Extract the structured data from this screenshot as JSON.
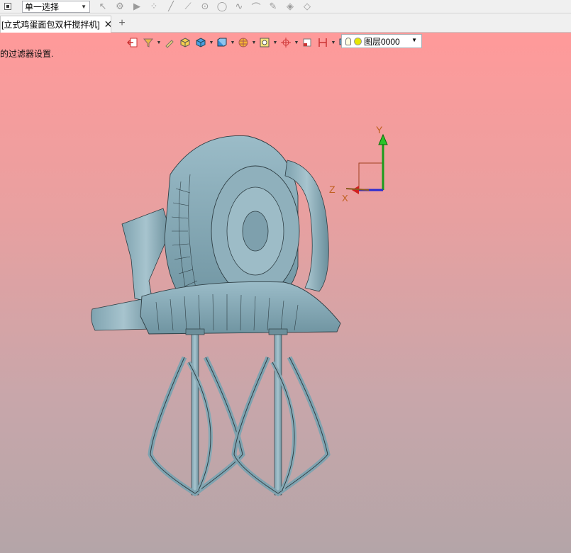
{
  "toolbar": {
    "select_mode": "单一选择",
    "icons": [
      "pointer-icon",
      "feature-select-icon",
      "play-icon",
      "point-cloud-icon",
      "line-icon",
      "line-alt-icon",
      "circle-point-icon",
      "circle-icon",
      "curve-icon",
      "arc-icon",
      "pen-icon",
      "layers-stack-icon",
      "layers-alt-icon"
    ]
  },
  "tabs": {
    "active_label": "[立式鸡蛋面包双杆搅拌机]",
    "new_tab": "+"
  },
  "viewport": {
    "status_text": "的过滤器设置.",
    "layer_selector": "图层0000"
  },
  "triad": {
    "y": "Y",
    "z": "Z",
    "x": "X"
  }
}
